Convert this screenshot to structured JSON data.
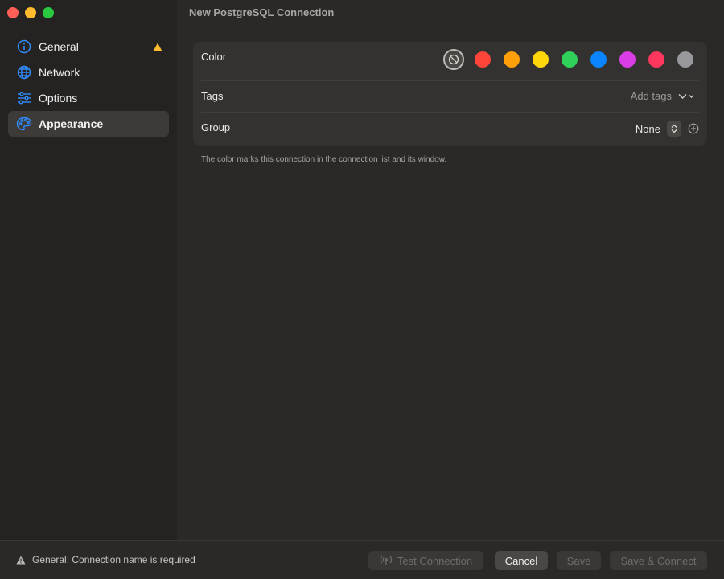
{
  "window": {
    "title": "New PostgreSQL Connection"
  },
  "sidebar": {
    "items": [
      {
        "label": "General",
        "icon": "info-icon",
        "warning": true
      },
      {
        "label": "Network",
        "icon": "globe-icon"
      },
      {
        "label": "Options",
        "icon": "sliders-icon"
      },
      {
        "label": "Appearance",
        "icon": "palette-icon",
        "active": true
      }
    ]
  },
  "appearance": {
    "color_label": "Color",
    "colors": [
      "none",
      "#ff453a",
      "#ff9f0a",
      "#ffd60a",
      "#30d158",
      "#0a84ff",
      "#da3ce6",
      "#ff375f",
      "#98989d"
    ],
    "tags_label": "Tags",
    "tags_placeholder": "Add tags",
    "group_label": "Group",
    "group_value": "None",
    "hint": "The color marks this connection in the connection list and its window."
  },
  "footer": {
    "status": "General: Connection name is required",
    "test_label": "Test Connection",
    "cancel_label": "Cancel",
    "save_label": "Save",
    "save_connect_label": "Save & Connect"
  },
  "colors": {
    "accent": "#0a84ff",
    "warning": "#febc2e"
  }
}
